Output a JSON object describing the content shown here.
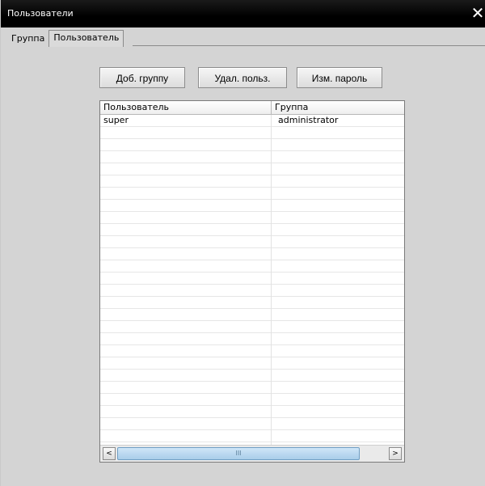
{
  "window": {
    "title": "Пользователи",
    "close_glyph": "✕"
  },
  "tabs": [
    {
      "label": "Группа",
      "active": false
    },
    {
      "label": "Пользователь",
      "active": true
    }
  ],
  "toolbar": {
    "add_group_label": "Доб. группу",
    "delete_user_label": "Удал. польз.",
    "change_password_label": "Изм. пароль"
  },
  "table": {
    "columns": [
      "Пользователь",
      "Группа"
    ],
    "rows": [
      [
        "super",
        "administrator"
      ]
    ]
  },
  "scrollbar": {
    "left_arrow": "<",
    "right_arrow": ">",
    "thumb_grip": "III"
  }
}
